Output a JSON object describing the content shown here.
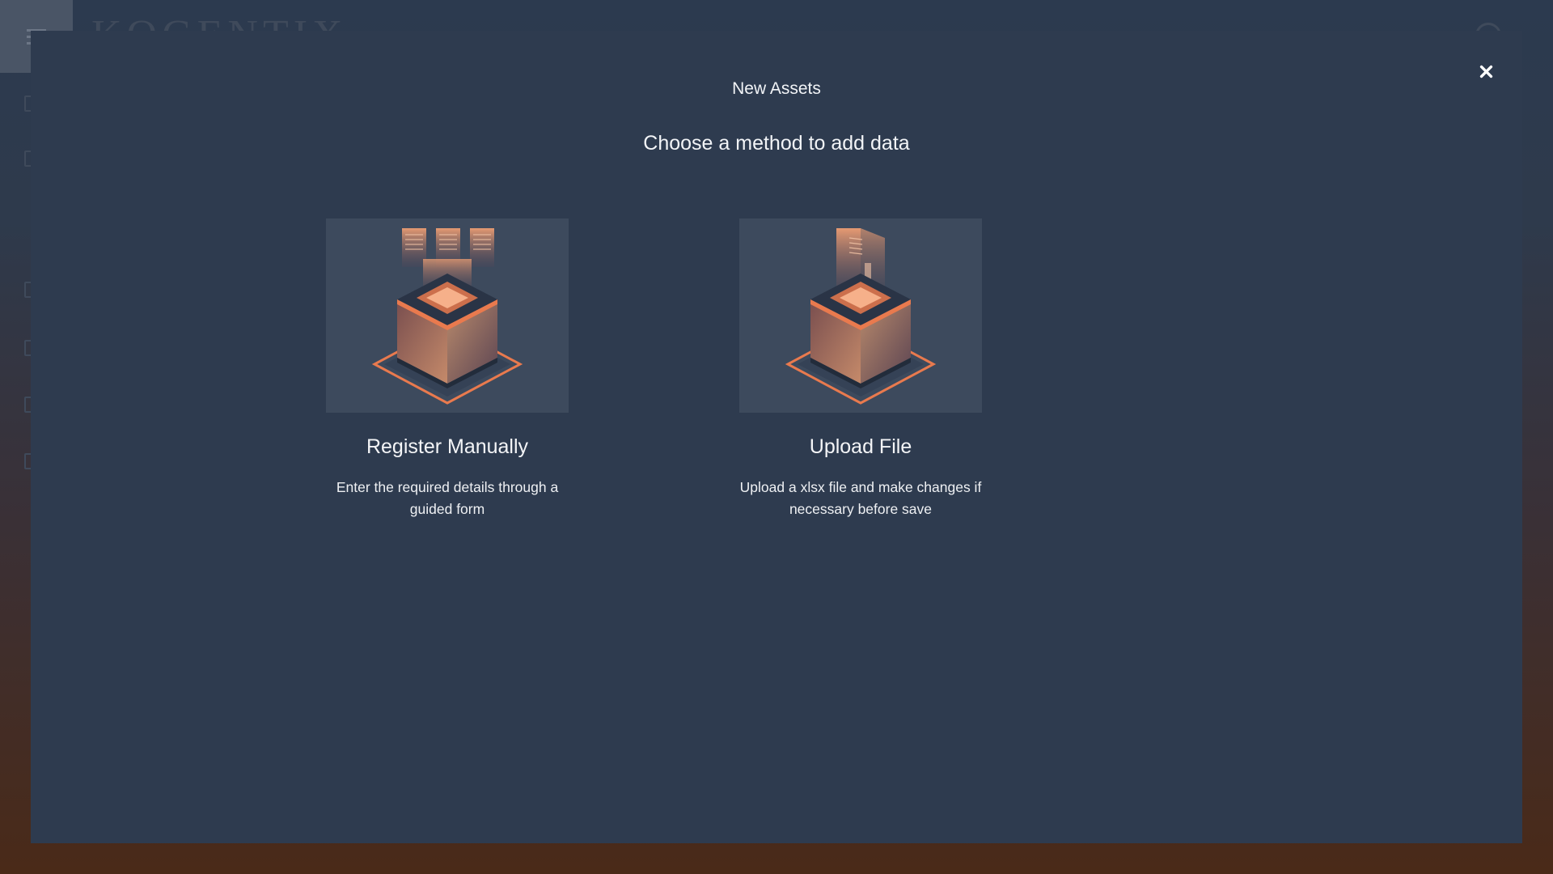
{
  "background": {
    "logo_text": "KOGENTIX"
  },
  "modal": {
    "title": "New Assets",
    "subtitle": "Choose a method to add data",
    "close_icon": "close-icon",
    "options": [
      {
        "label": "Register Manually",
        "description": "Enter the required details through a guided form",
        "icon": "register-manually-illustration"
      },
      {
        "label": "Upload File",
        "description": "Upload a xlsx file and make changes if necessary before save",
        "icon": "upload-file-illustration"
      }
    ]
  },
  "colors": {
    "modal_bg": "#2e3b4f",
    "card_bg": "#3d4a5d",
    "accent": "#e97a4e",
    "text": "#f2f4f7"
  }
}
